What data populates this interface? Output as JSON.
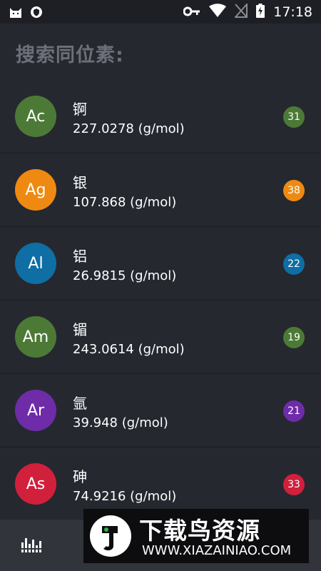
{
  "status": {
    "time": "17:18"
  },
  "header": {
    "title": "搜索同位素:"
  },
  "elements": [
    {
      "symbol": "Ac",
      "name": "锕",
      "mass": "227.0278 (g/mol)",
      "count": "31",
      "color": "#4c7a36"
    },
    {
      "symbol": "Ag",
      "name": "银",
      "mass": "107.868 (g/mol)",
      "count": "38",
      "color": "#ee8a12"
    },
    {
      "symbol": "Al",
      "name": "铝",
      "mass": "26.9815 (g/mol)",
      "count": "22",
      "color": "#0f6ea3"
    },
    {
      "symbol": "Am",
      "name": "镅",
      "mass": "243.0614 (g/mol)",
      "count": "19",
      "color": "#4c7a36"
    },
    {
      "symbol": "Ar",
      "name": "氩",
      "mass": "39.948 (g/mol)",
      "count": "21",
      "color": "#6e2ca8"
    },
    {
      "symbol": "As",
      "name": "砷",
      "mass": "74.9216 (g/mol)",
      "count": "33",
      "color": "#d1203c"
    }
  ],
  "watermark": {
    "title": "下载鸟资源",
    "url": "WWW.XIAZAINIAO.COM"
  },
  "icons": {
    "cat": "cat-icon",
    "shield": "shield-icon",
    "key": "key-icon",
    "wifi": "wifi-icon",
    "signal": "no-signal-icon",
    "battery": "battery-charging-icon",
    "equalizer": "equalizer-icon"
  }
}
